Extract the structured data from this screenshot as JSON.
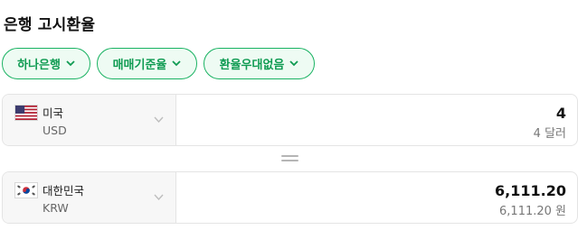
{
  "title": "은행 고시환율",
  "filters": [
    {
      "label": "하나은행"
    },
    {
      "label": "매매기준율"
    },
    {
      "label": "환율우대없음"
    }
  ],
  "from": {
    "name": "미국",
    "code": "USD",
    "amount": "4",
    "amount_sub": "4 달러",
    "flag": "us-flag-icon"
  },
  "to": {
    "name": "대한민국",
    "code": "KRW",
    "amount": "6,111.20",
    "amount_sub": "6,111.20 원",
    "flag": "kr-flag-icon"
  },
  "colors": {
    "accent": "#19b262",
    "accent_text": "#0f9b52",
    "chip_bg": "#eefbf3"
  }
}
